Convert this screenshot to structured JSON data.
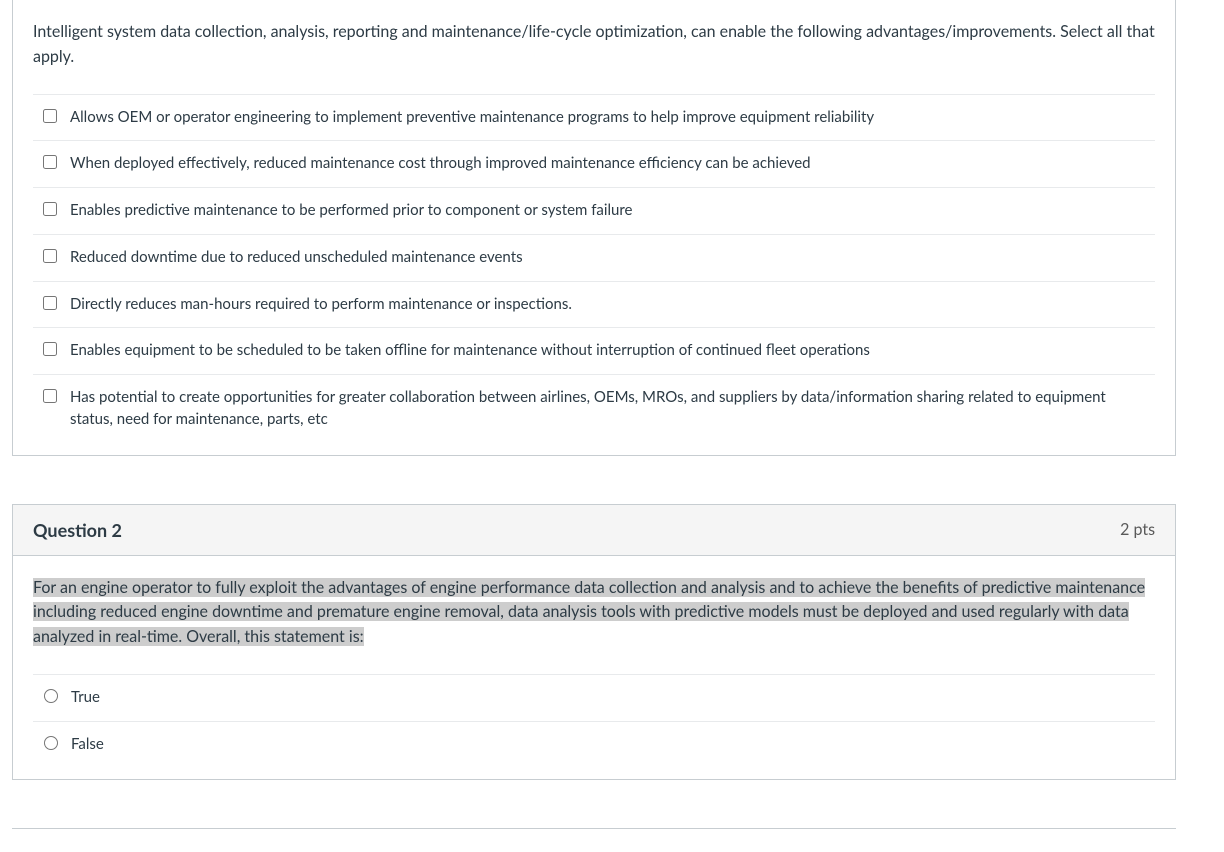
{
  "q1": {
    "prompt": "Intelligent system data collection, analysis, reporting and maintenance/life-cycle optimization, can enable the following advantages/improvements.  Select all that apply.",
    "options": [
      "Allows OEM or operator engineering to implement preventive maintenance programs to help improve equipment reliability",
      "When deployed effectively, reduced maintenance cost through improved maintenance efficiency can be achieved",
      "Enables predictive maintenance to be performed prior to component or system failure",
      "Reduced downtime due to reduced unscheduled maintenance events",
      "Directly reduces man-hours required to perform maintenance or inspections.",
      "Enables equipment to be scheduled to be taken offline for maintenance without interruption of continued fleet operations",
      "Has potential to create opportunities for greater collaboration between airlines, OEMs, MROs, and suppliers by data/information sharing related to equipment status, need for maintenance, parts, etc"
    ]
  },
  "q2": {
    "title": "Question 2",
    "points": "2 pts",
    "prompt": "For an engine operator to fully exploit the advantages of engine performance data collection and analysis and to achieve the benefits of predictive maintenance including reduced engine downtime and premature engine removal, data analysis tools with predictive models must be deployed and used regularly with data analyzed in real-time.  Overall, this statement is:",
    "options": [
      "True",
      "False"
    ]
  }
}
